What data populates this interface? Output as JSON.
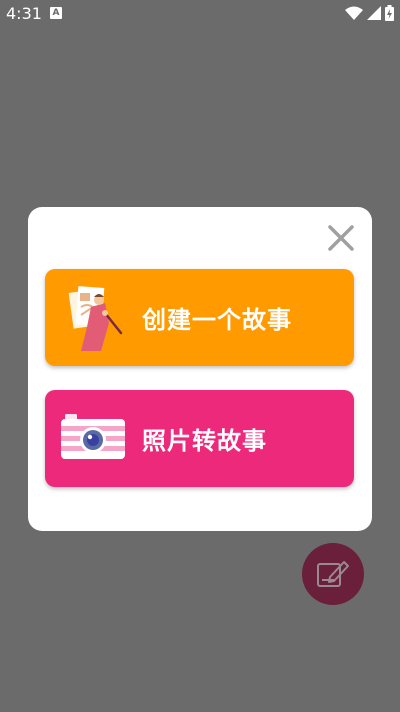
{
  "status_bar": {
    "time": "4:31",
    "notification_glyph": "A",
    "icons": [
      "wifi-icon",
      "signal-icon",
      "battery-charging-icon"
    ]
  },
  "background": {
    "fab_icon": "compose-icon"
  },
  "dialog": {
    "close_icon": "close-icon",
    "options": [
      {
        "label": "创建一个故事",
        "color": "#ff9a00",
        "icon": "drawing-illustration-icon"
      },
      {
        "label": "照片转故事",
        "color": "#ec297b",
        "icon": "camera-illustration-icon"
      }
    ]
  },
  "colors": {
    "scrim": "#6b6b6b",
    "dialog_bg": "#ffffff",
    "fab": "#6a1f3b",
    "close_icon": "#a0a0a0"
  }
}
